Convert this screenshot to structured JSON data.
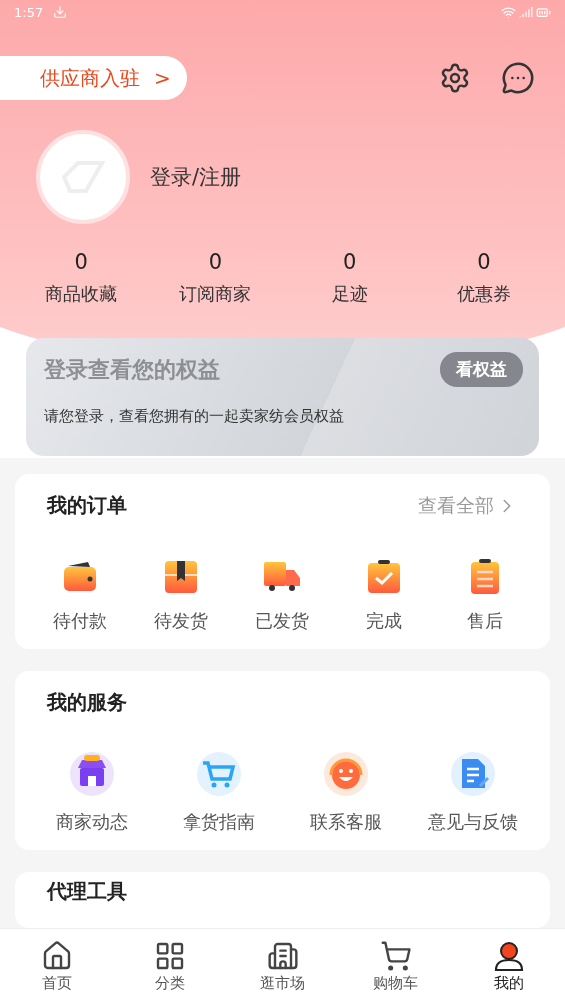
{
  "status_bar": {
    "time": "1:57"
  },
  "header": {
    "supplier_button": "供应商入驻",
    "supplier_arrow": ">",
    "login": "登录/注册"
  },
  "stats": [
    {
      "value": "0",
      "label": "商品收藏"
    },
    {
      "value": "0",
      "label": "订阅商家"
    },
    {
      "value": "0",
      "label": "足迹"
    },
    {
      "value": "0",
      "label": "优惠券"
    }
  ],
  "benefits": {
    "title": "登录查看您的权益",
    "button": "看权益",
    "text": "请您登录，查看您拥有的一起卖家纺会员权益"
  },
  "orders": {
    "title": "我的订单",
    "view_all": "查看全部",
    "items": [
      {
        "kind": "wallet",
        "label": "待付款"
      },
      {
        "kind": "box",
        "label": "待发货"
      },
      {
        "kind": "truck",
        "label": "已发货"
      },
      {
        "kind": "check",
        "label": "完成"
      },
      {
        "kind": "clipboard",
        "label": "售后"
      }
    ]
  },
  "services": {
    "title": "我的服务",
    "items": [
      {
        "kind": "store",
        "label": "商家动态"
      },
      {
        "kind": "cart",
        "label": "拿货指南"
      },
      {
        "kind": "support",
        "label": "联系客服"
      },
      {
        "kind": "feedback",
        "label": "意见与反馈"
      }
    ]
  },
  "agent_tools": {
    "title": "代理工具"
  },
  "tab_bar": [
    {
      "kind": "home",
      "label": "首页",
      "selected": false
    },
    {
      "kind": "grid",
      "label": "分类",
      "selected": false
    },
    {
      "kind": "market",
      "label": "逛市场",
      "selected": false
    },
    {
      "kind": "cart",
      "label": "购物车",
      "selected": false
    },
    {
      "kind": "user",
      "label": "我的",
      "selected": true
    }
  ]
}
